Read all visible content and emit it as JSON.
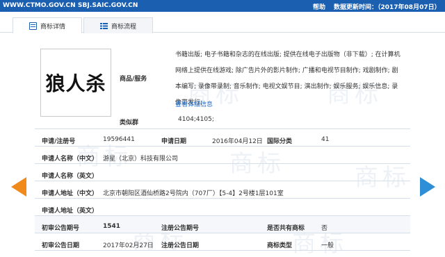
{
  "topbar": {
    "sites": "WWW.CTMO.GOV.CN SBJ.SAIC.GOV.CN",
    "help": "帮助",
    "update": "数据更新时间：（2017年08月07日）"
  },
  "tabs": [
    {
      "label": "商标详情",
      "icon": "document-icon"
    },
    {
      "label": "商标流程",
      "icon": "list-icon"
    }
  ],
  "watermark": "商标",
  "trademark": {
    "logo_text": "狼人杀"
  },
  "goods": {
    "label": "商品/服务",
    "text": "书籍出版; 电子书籍和杂志的在线出版; 提供在线电子出版物（非下载）; 在计算机网络上提供在线游戏; 除广告片外的影片制作; 广播和电视节目制作; 戏剧制作; 剧本编写; 录像带录制; 音乐制作; 电视文娱节目; 演出制作; 娱乐服务; 娱乐信息; 录像带发行;",
    "more_link": "查看详细信息"
  },
  "similar_group": {
    "label": "类似群",
    "value": "4104;4105;"
  },
  "fields": {
    "reg_no_label": "申请/注册号",
    "reg_no": "19596441",
    "apply_date_label": "申请日期",
    "apply_date": "2016年04月12日",
    "intl_class_label": "国际分类",
    "intl_class": "41",
    "applicant_cn_label": "申请人名称（中文）",
    "applicant_cn": "游星（北京）科技有限公司",
    "applicant_en_label": "申请人名称（英文）",
    "applicant_en": "",
    "address_cn_label": "申请人地址（中文）",
    "address_cn": "北京市朝阳区酒仙桥路2号院内（707厂）【5-4】2号楼1层101室",
    "address_en_label": "申请人地址（英文）",
    "address_en": "",
    "prelim_pub_no_label": "初审公告期号",
    "prelim_pub_no": "1541",
    "reg_pub_no_label": "注册公告期号",
    "reg_pub_no": "",
    "shared_label": "是否共有商标",
    "shared": "否",
    "prelim_pub_date_label": "初审公告日期",
    "prelim_pub_date": "2017年02月27日",
    "reg_pub_date_label": "注册公告日期",
    "reg_pub_date": "",
    "type_label": "商标类型",
    "type": "一般"
  },
  "nav": {
    "prev_icon": "arrow-left-icon",
    "next_icon": "arrow-right-icon",
    "prev_color": "#f08a1a",
    "next_color": "#2e8fd6"
  },
  "colors": {
    "topbar": "#1a5fb0",
    "link": "#1a6fd0"
  }
}
